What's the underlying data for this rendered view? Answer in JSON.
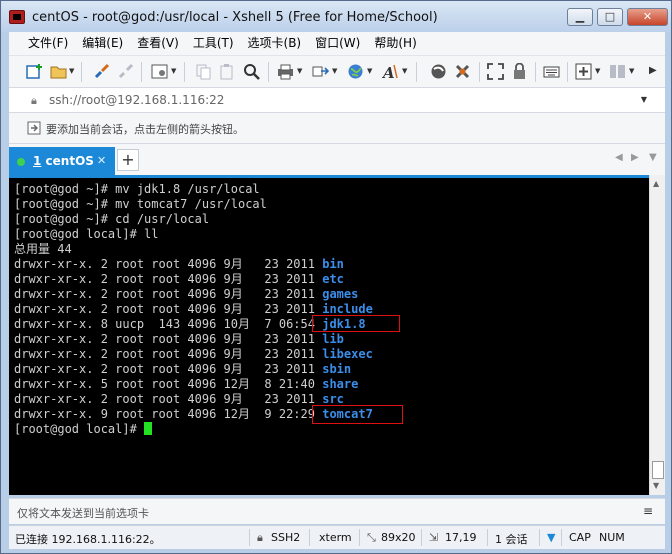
{
  "window": {
    "title": "centOS - root@god:/usr/local - Xshell 5 (Free for Home/School)",
    "buttons": {
      "minimize": "▁",
      "maximize": "□",
      "close": "✕"
    }
  },
  "menu": [
    "文件(F)",
    "编辑(E)",
    "查看(V)",
    "工具(T)",
    "选项卡(B)",
    "窗口(W)",
    "帮助(H)"
  ],
  "toolbar": {
    "icons": [
      "new-session-icon",
      "open-folder-icon",
      "connect-icon",
      "disconnect-icon",
      "properties-icon",
      "copy-icon",
      "paste-icon",
      "find-icon",
      "print-icon",
      "transfer-icon",
      "globe-icon",
      "font-icon",
      "xftp-icon",
      "xmanager-icon",
      "fullscreen-icon",
      "lock-icon",
      "keyboard-icon",
      "add-icon",
      "layout-icon",
      "help-icon"
    ]
  },
  "address": {
    "text": "ssh://root@192.168.1.116:22"
  },
  "hint": {
    "text": "要添加当前会话，点击左侧的箭头按钮。"
  },
  "tabs": [
    {
      "number": "1",
      "label": "centOS",
      "close": "✕"
    }
  ],
  "tab_add": "+",
  "terminal": {
    "lines": [
      "[root@god ~]# mv jdk1.8 /usr/local",
      "[root@god ~]# mv tomcat7 /usr/local",
      "[root@god ~]# cd /usr/local",
      "[root@god local]# ll",
      "总用量 44"
    ],
    "entries": [
      {
        "prefix": "drwxr-xr-x. 2 root root 4096 9月   23 2011 ",
        "name": "bin"
      },
      {
        "prefix": "drwxr-xr-x. 2 root root 4096 9月   23 2011 ",
        "name": "etc"
      },
      {
        "prefix": "drwxr-xr-x. 2 root root 4096 9月   23 2011 ",
        "name": "games"
      },
      {
        "prefix": "drwxr-xr-x. 2 root root 4096 9月   23 2011 ",
        "name": "include"
      },
      {
        "prefix": "drwxr-xr-x. 8 uucp  143 4096 10月  7 06:54 ",
        "name": "jdk1.8"
      },
      {
        "prefix": "drwxr-xr-x. 2 root root 4096 9月   23 2011 ",
        "name": "lib"
      },
      {
        "prefix": "drwxr-xr-x. 2 root root 4096 9月   23 2011 ",
        "name": "libexec"
      },
      {
        "prefix": "drwxr-xr-x. 2 root root 4096 9月   23 2011 ",
        "name": "sbin"
      },
      {
        "prefix": "drwxr-xr-x. 5 root root 4096 12月  8 21:40 ",
        "name": "share"
      },
      {
        "prefix": "drwxr-xr-x. 2 root root 4096 9月   23 2011 ",
        "name": "src"
      },
      {
        "prefix": "drwxr-xr-x. 9 root root 4096 12月  9 22:29 ",
        "name": "tomcat7"
      }
    ],
    "prompt": "[root@god local]# "
  },
  "compose": {
    "placeholder": "仅将文本发送到当前选项卡",
    "menu": "≡"
  },
  "status": {
    "connection": "已连接 192.168.1.116:22。",
    "protocol": "SSH2",
    "terminal_type": "xterm",
    "size": "89x20",
    "cursor": "17,19",
    "sessions": "1 会话",
    "caps": "CAP",
    "num": "NUM"
  },
  "colors": {
    "tab_active": "#1b89d7",
    "cursor": "#22e022",
    "dir_name": "#3b8eea",
    "highlight_box": "#dd1111"
  }
}
